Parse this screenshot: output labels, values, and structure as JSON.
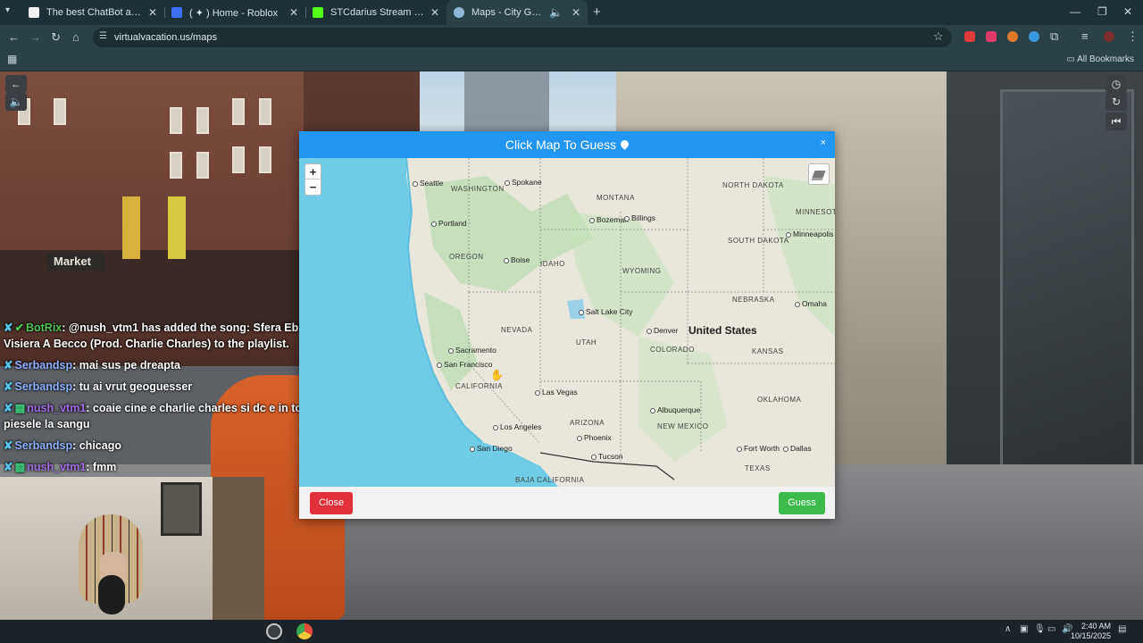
{
  "browser": {
    "tabs": [
      {
        "title": "The best ChatBot and Widg",
        "favicon_color": "#f0f0f0"
      },
      {
        "title": "( ✦ ) Home - Roblox",
        "favicon_color": "#3b6ef7"
      },
      {
        "title": "STCdarius Stream - Watch Live",
        "favicon_color": "#53fc18"
      },
      {
        "title": "Maps - City Guesser",
        "favicon_color": "#8fb8d8"
      }
    ],
    "url": "virtualvacation.us/maps",
    "bookmarks_label": "All Bookmarks"
  },
  "chat": [
    {
      "user": "BotRix",
      "user_color": "#4ec44e",
      "text": ": @nush_vtm1 has added the song: Sfera Ebbasta - Visiera A Becco (Prod. Charlie Charles) to the playlist."
    },
    {
      "user": "Serbandsp",
      "user_color": "#8fb1ff",
      "text": ": mai sus pe dreapta"
    },
    {
      "user": "Serbandsp",
      "user_color": "#8fb1ff",
      "text": ": tu ai vrut geoguesser"
    },
    {
      "user": "nush_vtm1",
      "user_color": "#a46ee6",
      "text": ": coaie cine e charlie charles si dc e in toate piesele la sangu"
    },
    {
      "user": "Serbandsp",
      "user_color": "#8fb1ff",
      "text": ": chicago"
    },
    {
      "user": "nush_vtm1",
      "user_color": "#a46ee6",
      "text": ": fmm"
    }
  ],
  "scene": {
    "market_sign": "Market"
  },
  "modal": {
    "title": "Click Map To Guess",
    "close_x": "×",
    "close_button": "Close",
    "guess_button": "Guess",
    "zoom_in": "+",
    "zoom_out": "−"
  },
  "map": {
    "country": "United States",
    "states": [
      "WASHINGTON",
      "MONTANA",
      "NORTH DAKOTA",
      "MINNESOTA",
      "OREGON",
      "IDAHO",
      "SOUTH DAKOTA",
      "WYOMING",
      "NEBRASKA",
      "NEVADA",
      "UTAH",
      "COLORADO",
      "KANSAS",
      "CALIFORNIA",
      "ARIZONA",
      "NEW MEXICO",
      "OKLAHOMA",
      "TEXAS",
      "BAJA CALIFORNIA"
    ],
    "cities": [
      "Seattle",
      "Spokane",
      "Bozeman",
      "Billings",
      "Portland",
      "Minneapolis",
      "Boise",
      "Salt Lake City",
      "Omaha",
      "Denver",
      "Sacramento",
      "San Francisco",
      "Las Vegas",
      "Albuquerque",
      "Los Angeles",
      "Phoenix",
      "San Diego",
      "Tucson",
      "Fort Worth",
      "Dallas"
    ]
  },
  "system": {
    "time": "2:40 AM",
    "date": "10/15/2025"
  }
}
